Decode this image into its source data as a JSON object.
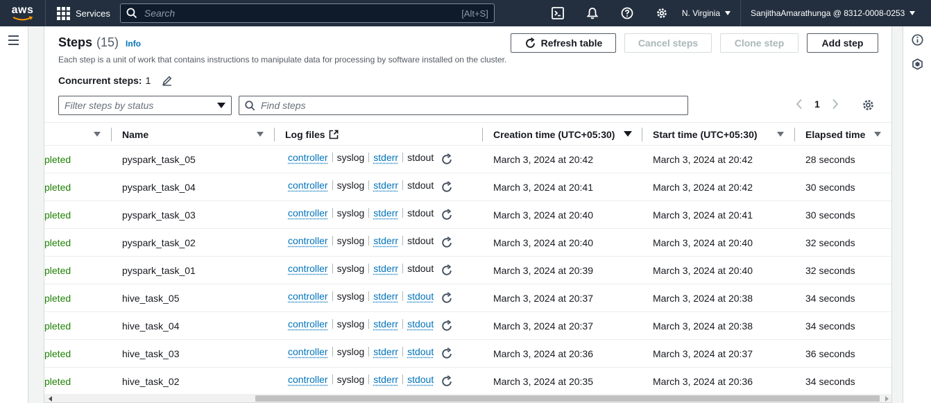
{
  "topnav": {
    "logo": "aws",
    "services_label": "Services",
    "search_placeholder": "Search",
    "search_shortcut": "[Alt+S]",
    "region": "N. Virginia",
    "account": "SanjithaAmarathunga @ 8312-0008-0253"
  },
  "header": {
    "title": "Steps",
    "count": "(15)",
    "info": "Info",
    "description": "Each step is a unit of work that contains instructions to manipulate data for processing by software installed on the cluster.",
    "concurrent_label": "Concurrent steps:",
    "concurrent_value": "1"
  },
  "actions": {
    "refresh": "Refresh table",
    "cancel": "Cancel steps",
    "clone": "Clone step",
    "add": "Add step"
  },
  "filters": {
    "status_placeholder": "Filter steps by status",
    "find_placeholder": "Find steps"
  },
  "pagination": {
    "page": "1"
  },
  "columns": {
    "name": "Name",
    "logs": "Log files",
    "creation": "Creation time (UTC+05:30)",
    "start": "Start time (UTC+05:30)",
    "elapsed": "Elapsed time"
  },
  "rows": [
    {
      "status": "pleted",
      "name": "pyspark_task_05",
      "log_controller": "controller",
      "log_syslog": "syslog",
      "log_stderr": "stderr",
      "log_stdout": "stdout",
      "stdout_link": false,
      "creation": "March 3, 2024 at 20:42",
      "start": "March 3, 2024 at 20:42",
      "elapsed": "28 seconds"
    },
    {
      "status": "pleted",
      "name": "pyspark_task_04",
      "log_controller": "controller",
      "log_syslog": "syslog",
      "log_stderr": "stderr",
      "log_stdout": "stdout",
      "stdout_link": false,
      "creation": "March 3, 2024 at 20:41",
      "start": "March 3, 2024 at 20:42",
      "elapsed": "30 seconds"
    },
    {
      "status": "pleted",
      "name": "pyspark_task_03",
      "log_controller": "controller",
      "log_syslog": "syslog",
      "log_stderr": "stderr",
      "log_stdout": "stdout",
      "stdout_link": false,
      "creation": "March 3, 2024 at 20:40",
      "start": "March 3, 2024 at 20:41",
      "elapsed": "30 seconds"
    },
    {
      "status": "pleted",
      "name": "pyspark_task_02",
      "log_controller": "controller",
      "log_syslog": "syslog",
      "log_stderr": "stderr",
      "log_stdout": "stdout",
      "stdout_link": false,
      "creation": "March 3, 2024 at 20:40",
      "start": "March 3, 2024 at 20:40",
      "elapsed": "32 seconds"
    },
    {
      "status": "pleted",
      "name": "pyspark_task_01",
      "log_controller": "controller",
      "log_syslog": "syslog",
      "log_stderr": "stderr",
      "log_stdout": "stdout",
      "stdout_link": false,
      "creation": "March 3, 2024 at 20:39",
      "start": "March 3, 2024 at 20:40",
      "elapsed": "32 seconds"
    },
    {
      "status": "pleted",
      "name": "hive_task_05",
      "log_controller": "controller",
      "log_syslog": "syslog",
      "log_stderr": "stderr",
      "log_stdout": "stdout",
      "stdout_link": true,
      "creation": "March 3, 2024 at 20:37",
      "start": "March 3, 2024 at 20:38",
      "elapsed": "34 seconds"
    },
    {
      "status": "pleted",
      "name": "hive_task_04",
      "log_controller": "controller",
      "log_syslog": "syslog",
      "log_stderr": "stderr",
      "log_stdout": "stdout",
      "stdout_link": true,
      "creation": "March 3, 2024 at 20:37",
      "start": "March 3, 2024 at 20:38",
      "elapsed": "34 seconds"
    },
    {
      "status": "pleted",
      "name": "hive_task_03",
      "log_controller": "controller",
      "log_syslog": "syslog",
      "log_stderr": "stderr",
      "log_stdout": "stdout",
      "stdout_link": true,
      "creation": "March 3, 2024 at 20:36",
      "start": "March 3, 2024 at 20:37",
      "elapsed": "36 seconds"
    },
    {
      "status": "pleted",
      "name": "hive_task_02",
      "log_controller": "controller",
      "log_syslog": "syslog",
      "log_stderr": "stderr",
      "log_stdout": "stdout",
      "stdout_link": true,
      "creation": "March 3, 2024 at 20:35",
      "start": "March 3, 2024 at 20:36",
      "elapsed": "34 seconds"
    }
  ],
  "colors": {
    "nav_bg": "#232f3e",
    "link": "#0073bb",
    "success": "#1d8102"
  },
  "icons": [
    "grid-icon",
    "search-icon",
    "cloudshell-icon",
    "bell-icon",
    "help-icon",
    "gear-icon",
    "menu-icon",
    "info-icon",
    "hexagon-icon",
    "refresh-icon",
    "pencil-icon",
    "external-link-icon",
    "chevron-left-icon",
    "chevron-right-icon",
    "caret-down-icon"
  ]
}
